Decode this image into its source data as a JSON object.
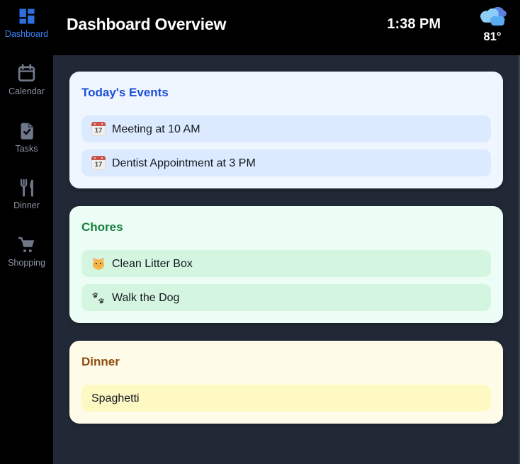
{
  "header": {
    "title": "Dashboard Overview",
    "time": "1:38 PM",
    "weather": {
      "icon": "clouds-icon",
      "temperature": "81°"
    }
  },
  "sidebar": {
    "items": [
      {
        "label": "Dashboard",
        "icon": "dashboard-grid-icon",
        "active": true
      },
      {
        "label": "Calendar",
        "icon": "calendar-icon",
        "active": false
      },
      {
        "label": "Tasks",
        "icon": "tasks-checklist-icon",
        "active": false
      },
      {
        "label": "Dinner",
        "icon": "fork-knife-icon",
        "active": false
      },
      {
        "label": "Shopping",
        "icon": "shopping-cart-icon",
        "active": false
      }
    ]
  },
  "icons": {
    "calendar_emoji_day": "17"
  },
  "cards": [
    {
      "title": "Today's Events",
      "accent": "#1d4ed8",
      "background": "#eff6ff",
      "item_background": "#dbeafe",
      "items": [
        {
          "emoji": "📅",
          "icon": "calendar-emoji",
          "label": "Meeting at 10 AM"
        },
        {
          "emoji": "📅",
          "icon": "calendar-emoji",
          "label": "Dentist Appointment at 3 PM"
        }
      ]
    },
    {
      "title": "Chores",
      "accent": "#15803d",
      "background": "#ecfdf5",
      "item_background": "#d4f5e0",
      "items": [
        {
          "emoji": "🐱",
          "icon": "cat-face-emoji",
          "label": "Clean Litter Box"
        },
        {
          "emoji": "🐾",
          "icon": "paw-prints-emoji",
          "label": "Walk the Dog"
        }
      ]
    },
    {
      "title": "Dinner",
      "accent": "#8e4a10",
      "background": "#fefce8",
      "item_background": "#fef9c3",
      "items": [
        {
          "emoji": null,
          "icon": null,
          "label": "Spaghetti"
        }
      ]
    }
  ],
  "theme": {
    "header_bg": "#000000",
    "sidebar_bg": "#000000",
    "content_bg": "#212936",
    "active_nav_color": "#3b82f6",
    "inactive_nav_color": "#8a93a3"
  }
}
